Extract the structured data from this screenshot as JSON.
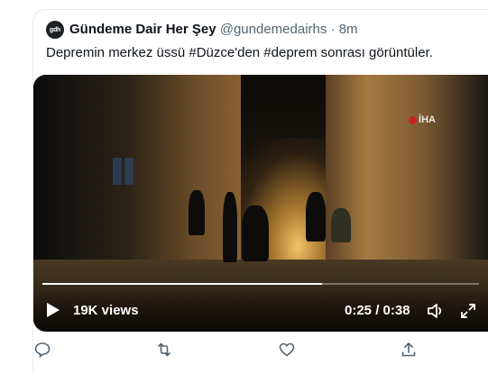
{
  "tweet": {
    "avatar_text": "gdh",
    "name": "Gündeme Dair Her Şey",
    "handle": "@gundemedairhs",
    "separator": "·",
    "time": "8m",
    "text": "Depremin merkez üssü #Düzce'den #deprem sonrası görüntüler."
  },
  "video": {
    "watermark": "İHA",
    "views": "19K views",
    "timecode": "0:25 / 0:38",
    "progress": 0.64
  },
  "colors": {
    "text_primary": "#0f1419",
    "text_secondary": "#536471",
    "icon": "#536471"
  },
  "actions": {
    "icons": [
      "reply-icon",
      "retweet-icon",
      "like-icon",
      "share-icon"
    ]
  }
}
